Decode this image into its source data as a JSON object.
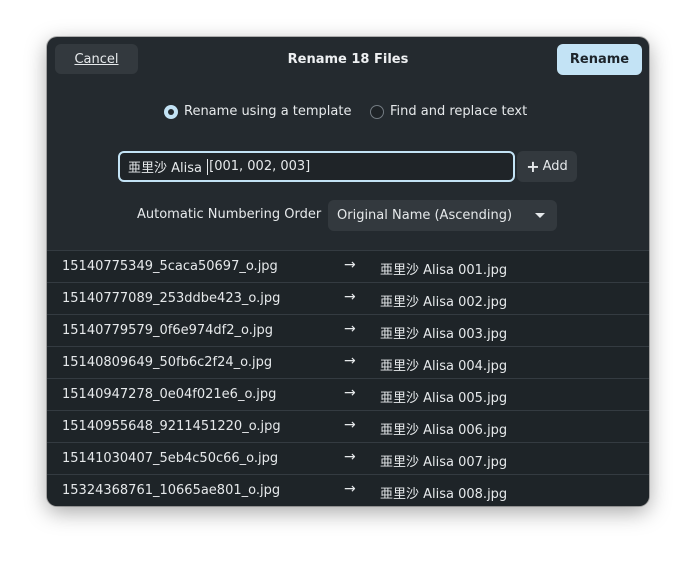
{
  "header": {
    "cancel_label": "Cancel",
    "title": "Rename 18 Files",
    "rename_label": "Rename"
  },
  "mode": {
    "template_option": "Rename using a template",
    "replace_option": "Find and replace text",
    "selected": "template"
  },
  "template": {
    "value_before_caret": "亜里沙 Alisa ",
    "value_after_caret": "[001, 002, 003]",
    "add_label": "Add"
  },
  "numbering": {
    "label": "Automatic Numbering Order",
    "selected": "Original Name (Ascending)"
  },
  "files": [
    {
      "old": "15140775349_5caca50697_o.jpg",
      "arrow": "→",
      "new": "亜里沙 Alisa 001.jpg"
    },
    {
      "old": "15140777089_253ddbe423_o.jpg",
      "arrow": "→",
      "new": "亜里沙 Alisa 002.jpg"
    },
    {
      "old": "15140779579_0f6e974df2_o.jpg",
      "arrow": "→",
      "new": "亜里沙 Alisa 003.jpg"
    },
    {
      "old": "15140809649_50fb6c2f24_o.jpg",
      "arrow": "→",
      "new": "亜里沙 Alisa 004.jpg"
    },
    {
      "old": "15140947278_0e04f021e6_o.jpg",
      "arrow": "→",
      "new": "亜里沙 Alisa 005.jpg"
    },
    {
      "old": "15140955648_9211451220_o.jpg",
      "arrow": "→",
      "new": "亜里沙 Alisa 006.jpg"
    },
    {
      "old": "15141030407_5eb4c50c66_o.jpg",
      "arrow": "→",
      "new": "亜里沙 Alisa 007.jpg"
    },
    {
      "old": "15324368761_10665ae801_o.jpg",
      "arrow": "→",
      "new": "亜里沙 Alisa 008.jpg"
    }
  ],
  "colors": {
    "accent": "#c3e3f5",
    "dialog_bg": "#242a2f",
    "list_bg": "#1e2428"
  }
}
